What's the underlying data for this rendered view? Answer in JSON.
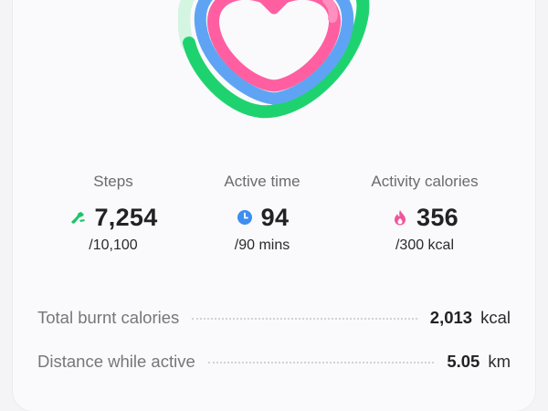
{
  "stats": [
    {
      "label": "Steps",
      "value": "7,254",
      "goal": "/10,100",
      "icon": "shoe-icon",
      "color": "#1ec46a"
    },
    {
      "label": "Active time",
      "value": "94",
      "goal": "/90 mins",
      "icon": "clock-icon",
      "color": "#3d8ef0"
    },
    {
      "label": "Activity calories",
      "value": "356",
      "goal": "/300 kcal",
      "icon": "flame-icon",
      "color": "#f0559b"
    }
  ],
  "summary": [
    {
      "label": "Total burnt calories",
      "value": "2,013",
      "unit": "kcal"
    },
    {
      "label": "Distance while active",
      "value": "5.05",
      "unit": "km"
    }
  ],
  "colors": {
    "steps_ring": "#1ed36f",
    "steps_track": "#d4f5e2",
    "active_ring": "#5fa4f4",
    "calories_ring": "#ff5fa0",
    "calories_ring_light": "#ff8fbf"
  }
}
